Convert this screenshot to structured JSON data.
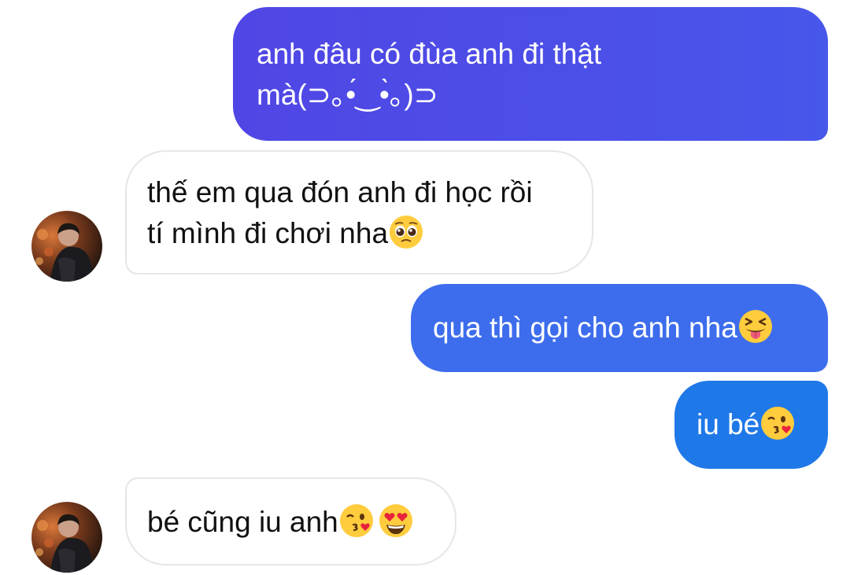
{
  "messages": [
    {
      "direction": "outgoing",
      "lines": [
        "anh đâu có đùa anh đi thật",
        "mà(⊃｡•́‿•̀｡)⊃"
      ]
    },
    {
      "direction": "incoming",
      "lines": [
        "thế em qua đón anh đi học rồi",
        "tí mình đi chơi nha"
      ],
      "emoji": [
        "pleading-face"
      ]
    },
    {
      "direction": "outgoing",
      "text": "qua thì gọi cho anh nha",
      "emoji": [
        "squinting-tongue-face"
      ]
    },
    {
      "direction": "outgoing",
      "text": "iu bé",
      "emoji": [
        "kissing-heart-face"
      ]
    },
    {
      "direction": "incoming",
      "text": "bé cũng iu anh",
      "emoji": [
        "kissing-heart-face",
        "heart-eyes-face"
      ]
    }
  ],
  "colors": {
    "outgoing_1": "#4c4fe8",
    "outgoing_2": "#3d6ded",
    "outgoing_3": "#1f78e8",
    "incoming_border": "#e6e6e6",
    "background": "#ffffff"
  },
  "icons": {
    "avatar": "contact-avatar"
  }
}
